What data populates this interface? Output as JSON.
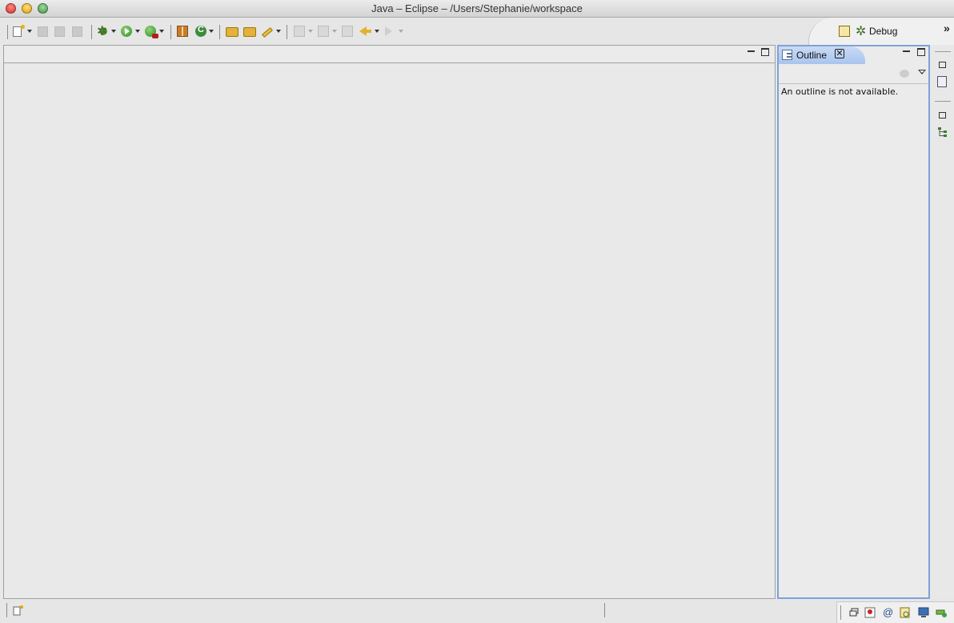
{
  "window": {
    "title": "Java – Eclipse – /Users/Stephanie/workspace"
  },
  "perspective": {
    "label": "Debug",
    "more_glyph": "»"
  },
  "outline": {
    "tab_label": "Outline",
    "close_glyph": "✕",
    "message": "An outline is not available."
  },
  "colors": {
    "active_view_border": "#7ea2d8",
    "active_tab": "#a9c4ee"
  },
  "icons": {
    "toolbar": [
      "new-wizard-icon",
      "save-icon",
      "save-all-icon",
      "print-icon",
      "debug-icon",
      "run-icon",
      "external-tools-icon",
      "new-package-icon",
      "new-class-icon",
      "open-type-icon",
      "open-task-icon",
      "edit-annotation-icon",
      "next-annotation-icon",
      "previous-annotation-icon",
      "last-edit-icon",
      "back-icon",
      "forward-icon"
    ],
    "statusbar": [
      "new-fast-view-icon",
      "restore-icon",
      "hierarchy-icon",
      "javadoc-icon",
      "declaration-icon",
      "console-icon",
      "progress-icon"
    ]
  }
}
